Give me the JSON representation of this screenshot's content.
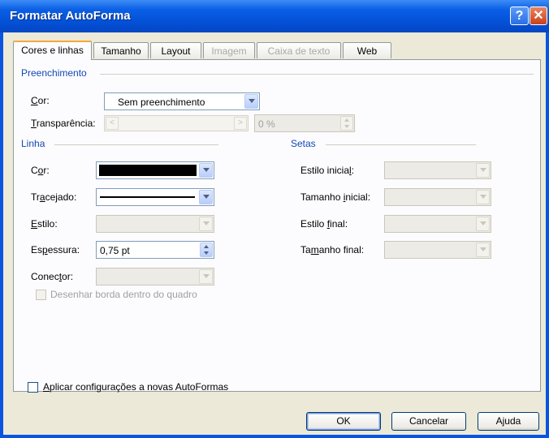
{
  "window": {
    "title": "Formatar AutoForma",
    "help_glyph": "?",
    "close_glyph": "✕"
  },
  "tabs": [
    {
      "label": "Cores e linhas",
      "active": true,
      "enabled": true
    },
    {
      "label": "Tamanho",
      "active": false,
      "enabled": true
    },
    {
      "label": "Layout",
      "active": false,
      "enabled": true
    },
    {
      "label": "Imagem",
      "active": false,
      "enabled": false
    },
    {
      "label": "Caixa de texto",
      "active": false,
      "enabled": false
    },
    {
      "label": "Web",
      "active": false,
      "enabled": true
    }
  ],
  "fill": {
    "section_title": "Preenchimento",
    "color_label": "Cor:",
    "color_value": "Sem preenchimento",
    "transparency_label": "Transparência:",
    "transparency_value": "0 %",
    "scroll_left_glyph": "<",
    "scroll_right_glyph": ">"
  },
  "line": {
    "section_title": "Linha",
    "color_label": "Cor:",
    "color_value": "#000000",
    "dash_label": "Tracejado:",
    "style_label": "Estilo:",
    "weight_label": "Espessura:",
    "weight_value": "0,75 pt",
    "connector_label": "Conector:",
    "draw_border_inside_label": "Desenhar borda dentro do quadro",
    "draw_border_inside_checked": false
  },
  "arrows": {
    "section_title": "Setas",
    "begin_style_label": "Estilo inicial:",
    "begin_size_label": "Tamanho inicial:",
    "end_style_label": "Estilo final:",
    "end_size_label": "Tamanho final:"
  },
  "apply_new_label": "Aplicar configurações a novas AutoFormas",
  "apply_new_checked": false,
  "buttons": {
    "ok": "OK",
    "cancel": "Cancelar",
    "help": "Ajuda"
  },
  "colors": {
    "titlebar": "#0a55e0",
    "dialog_face": "#ece9d8",
    "section_title": "#1447b4",
    "active_tab_accent": "#f5a83a"
  }
}
